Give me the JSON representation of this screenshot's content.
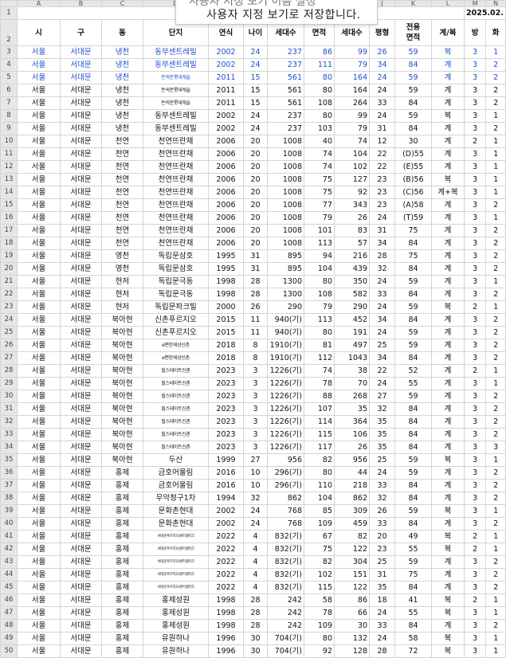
{
  "columns": [
    "A",
    "B",
    "C",
    "D",
    "E",
    "F",
    "G",
    "H",
    "I",
    "J",
    "K",
    "L",
    "M",
    "N"
  ],
  "date_label": "2025.02.",
  "tooltip": {
    "line1": "사용자 지정 보기 이름 설정",
    "line2": "사용자 지정 보기로 저장합니다."
  },
  "headers": [
    "시",
    "구",
    "동",
    "단지",
    "연식",
    "나이",
    "세대수",
    "면적",
    "세대수",
    "평형",
    "전용\n면적",
    "계/복",
    "방",
    "화"
  ],
  "rows": [
    [
      "서울",
      "서대문",
      "냉천",
      "동부센트레빌",
      "2002",
      "24",
      "237",
      "86",
      "99",
      "26",
      "59",
      "복",
      "3",
      "1"
    ],
    [
      "서울",
      "서대문",
      "냉천",
      "동부센트레빌",
      "2002",
      "24",
      "237",
      "111",
      "79",
      "34",
      "84",
      "계",
      "3",
      "2"
    ],
    [
      "서울",
      "서대문",
      "냉천",
      "돈의문롯데캐슬",
      "2011",
      "15",
      "561",
      "80",
      "164",
      "24",
      "59",
      "계",
      "3",
      "2"
    ],
    [
      "서울",
      "서대문",
      "냉천",
      "돈의문롯데캐슬",
      "2011",
      "15",
      "561",
      "80",
      "164",
      "24",
      "59",
      "계",
      "3",
      "2"
    ],
    [
      "서울",
      "서대문",
      "냉천",
      "돈의문롯데캐슬",
      "2011",
      "15",
      "561",
      "108",
      "264",
      "33",
      "84",
      "계",
      "3",
      "2"
    ],
    [
      "서울",
      "서대문",
      "냉천",
      "동부센트레빌",
      "2002",
      "24",
      "237",
      "80",
      "99",
      "24",
      "59",
      "복",
      "3",
      "1"
    ],
    [
      "서울",
      "서대문",
      "냉천",
      "동부센트레빌",
      "2002",
      "24",
      "237",
      "103",
      "79",
      "31",
      "84",
      "계",
      "3",
      "2"
    ],
    [
      "서울",
      "서대문",
      "천연",
      "천연뜨란채",
      "2006",
      "20",
      "1008",
      "40",
      "74",
      "12",
      "30",
      "계",
      "2",
      "1"
    ],
    [
      "서울",
      "서대문",
      "천연",
      "천연뜨란채",
      "2006",
      "20",
      "1008",
      "74",
      "104",
      "22",
      "(D)55",
      "계",
      "3",
      "1"
    ],
    [
      "서울",
      "서대문",
      "천연",
      "천연뜨란채",
      "2006",
      "20",
      "1008",
      "74",
      "102",
      "22",
      "(E)55",
      "계",
      "3",
      "1"
    ],
    [
      "서울",
      "서대문",
      "천연",
      "천연뜨란채",
      "2006",
      "20",
      "1008",
      "75",
      "127",
      "23",
      "(B)56",
      "복",
      "3",
      "1"
    ],
    [
      "서울",
      "서대문",
      "천연",
      "천연뜨란채",
      "2006",
      "20",
      "1008",
      "75",
      "92",
      "23",
      "(C)56",
      "계+복",
      "3",
      "1"
    ],
    [
      "서울",
      "서대문",
      "천연",
      "천연뜨란채",
      "2006",
      "20",
      "1008",
      "77",
      "343",
      "23",
      "(A)58",
      "계",
      "3",
      "2"
    ],
    [
      "서울",
      "서대문",
      "천연",
      "천연뜨란채",
      "2006",
      "20",
      "1008",
      "79",
      "26",
      "24",
      "(T)59",
      "계",
      "3",
      "1"
    ],
    [
      "서울",
      "서대문",
      "천연",
      "천연뜨란채",
      "2006",
      "20",
      "1008",
      "101",
      "83",
      "31",
      "75",
      "계",
      "3",
      "2"
    ],
    [
      "서울",
      "서대문",
      "천연",
      "천연뜨란채",
      "2006",
      "20",
      "1008",
      "113",
      "57",
      "34",
      "84",
      "계",
      "3",
      "2"
    ],
    [
      "서울",
      "서대문",
      "영천",
      "독립문삼호",
      "1995",
      "31",
      "895",
      "94",
      "216",
      "28",
      "75",
      "계",
      "3",
      "2"
    ],
    [
      "서울",
      "서대문",
      "영천",
      "독립문삼호",
      "1995",
      "31",
      "895",
      "104",
      "439",
      "32",
      "84",
      "계",
      "3",
      "2"
    ],
    [
      "서울",
      "서대문",
      "현저",
      "독립문극동",
      "1998",
      "28",
      "1300",
      "80",
      "350",
      "24",
      "59",
      "계",
      "3",
      "1"
    ],
    [
      "서울",
      "서대문",
      "현저",
      "독립문극동",
      "1998",
      "28",
      "1300",
      "108",
      "582",
      "33",
      "84",
      "계",
      "3",
      "2"
    ],
    [
      "서울",
      "서대문",
      "현저",
      "독립문파크빌",
      "2000",
      "26",
      "290",
      "79",
      "290",
      "24",
      "59",
      "복",
      "2",
      "1"
    ],
    [
      "서울",
      "서대문",
      "북아현",
      "신촌푸르지오",
      "2015",
      "11",
      "940(기)",
      "113",
      "452",
      "34",
      "84",
      "계",
      "3",
      "2"
    ],
    [
      "서울",
      "서대문",
      "북아현",
      "신촌푸르지오",
      "2015",
      "11",
      "940(기)",
      "80",
      "191",
      "24",
      "59",
      "계",
      "3",
      "2"
    ],
    [
      "서울",
      "서대문",
      "북아현",
      "e편한세상신촌",
      "2018",
      "8",
      "1910(기)",
      "81",
      "497",
      "25",
      "59",
      "계",
      "3",
      "2"
    ],
    [
      "서울",
      "서대문",
      "북아현",
      "e편한세상신촌",
      "2018",
      "8",
      "1910(기)",
      "112",
      "1043",
      "34",
      "84",
      "계",
      "3",
      "2"
    ],
    [
      "서울",
      "서대문",
      "북아현",
      "힐스테이트신촌",
      "2023",
      "3",
      "1226(기)",
      "74",
      "38",
      "22",
      "52",
      "계",
      "2",
      "1"
    ],
    [
      "서울",
      "서대문",
      "북아현",
      "힐스테이트신촌",
      "2023",
      "3",
      "1226(기)",
      "78",
      "70",
      "24",
      "55",
      "계",
      "3",
      "1"
    ],
    [
      "서울",
      "서대문",
      "북아현",
      "힐스테이트신촌",
      "2023",
      "3",
      "1226(기)",
      "88",
      "268",
      "27",
      "59",
      "계",
      "3",
      "2"
    ],
    [
      "서울",
      "서대문",
      "북아현",
      "힐스테이트신촌",
      "2023",
      "3",
      "1226(기)",
      "107",
      "35",
      "32",
      "84",
      "계",
      "3",
      "2"
    ],
    [
      "서울",
      "서대문",
      "북아현",
      "힐스테이트신촌",
      "2023",
      "3",
      "1226(기)",
      "114",
      "364",
      "35",
      "84",
      "계",
      "3",
      "2"
    ],
    [
      "서울",
      "서대문",
      "북아현",
      "힐스테이트신촌",
      "2023",
      "3",
      "1226(기)",
      "115",
      "106",
      "35",
      "84",
      "계",
      "3",
      "2"
    ],
    [
      "서울",
      "서대문",
      "북아현",
      "힐스테이트신촌",
      "2023",
      "3",
      "1226(기)",
      "117",
      "26",
      "35",
      "84",
      "계",
      "3",
      "3"
    ],
    [
      "서울",
      "서대문",
      "북아현",
      "두산",
      "1999",
      "27",
      "956",
      "82",
      "956",
      "25",
      "59",
      "복",
      "3",
      "1"
    ],
    [
      "서울",
      "서대문",
      "홍제",
      "금호어울림",
      "2016",
      "10",
      "296(기)",
      "80",
      "44",
      "24",
      "59",
      "계",
      "3",
      "2"
    ],
    [
      "서울",
      "서대문",
      "홍제",
      "금호어울림",
      "2016",
      "10",
      "296(기)",
      "110",
      "218",
      "33",
      "84",
      "계",
      "3",
      "2"
    ],
    [
      "서울",
      "서대문",
      "홍제",
      "무악청구1차",
      "1994",
      "32",
      "862",
      "104",
      "862",
      "32",
      "84",
      "계",
      "3",
      "2"
    ],
    [
      "서울",
      "서대문",
      "홍제",
      "문화촌현대",
      "2002",
      "24",
      "768",
      "85",
      "309",
      "26",
      "59",
      "복",
      "3",
      "1"
    ],
    [
      "서울",
      "서대문",
      "홍제",
      "문화촌현대",
      "2002",
      "24",
      "768",
      "109",
      "459",
      "33",
      "84",
      "계",
      "3",
      "2"
    ],
    [
      "서울",
      "서대문",
      "홍제",
      "서대문푸르지오센트럴파크",
      "2022",
      "4",
      "832(기)",
      "67",
      "82",
      "20",
      "49",
      "복",
      "2",
      "1"
    ],
    [
      "서울",
      "서대문",
      "홍제",
      "서대문푸르지오센트럴파크",
      "2022",
      "4",
      "832(기)",
      "75",
      "122",
      "23",
      "55",
      "복",
      "2",
      "1"
    ],
    [
      "서울",
      "서대문",
      "홍제",
      "서대문푸르지오센트럴파크",
      "2022",
      "4",
      "832(기)",
      "82",
      "304",
      "25",
      "59",
      "계",
      "3",
      "2"
    ],
    [
      "서울",
      "서대문",
      "홍제",
      "서대문푸르지오센트럴파크",
      "2022",
      "4",
      "832(기)",
      "102",
      "151",
      "31",
      "75",
      "계",
      "3",
      "2"
    ],
    [
      "서울",
      "서대문",
      "홍제",
      "서대문푸르지오센트럴파크",
      "2022",
      "4",
      "832(기)",
      "115",
      "122",
      "35",
      "84",
      "계",
      "3",
      "2"
    ],
    [
      "서울",
      "서대문",
      "홍제",
      "홍제성원",
      "1998",
      "28",
      "242",
      "58",
      "86",
      "18",
      "41",
      "복",
      "2",
      "1"
    ],
    [
      "서울",
      "서대문",
      "홍제",
      "홍제성원",
      "1998",
      "28",
      "242",
      "78",
      "66",
      "24",
      "55",
      "복",
      "3",
      "1"
    ],
    [
      "서울",
      "서대문",
      "홍제",
      "홍제성원",
      "1998",
      "28",
      "242",
      "109",
      "30",
      "33",
      "84",
      "계",
      "3",
      "2"
    ],
    [
      "서울",
      "서대문",
      "홍제",
      "유원하나",
      "1996",
      "30",
      "704(기)",
      "80",
      "132",
      "24",
      "58",
      "복",
      "3",
      "1"
    ],
    [
      "서울",
      "서대문",
      "홍제",
      "유원하나",
      "1996",
      "30",
      "704(기)",
      "92",
      "128",
      "28",
      "72",
      "복",
      "3",
      "1"
    ]
  ]
}
